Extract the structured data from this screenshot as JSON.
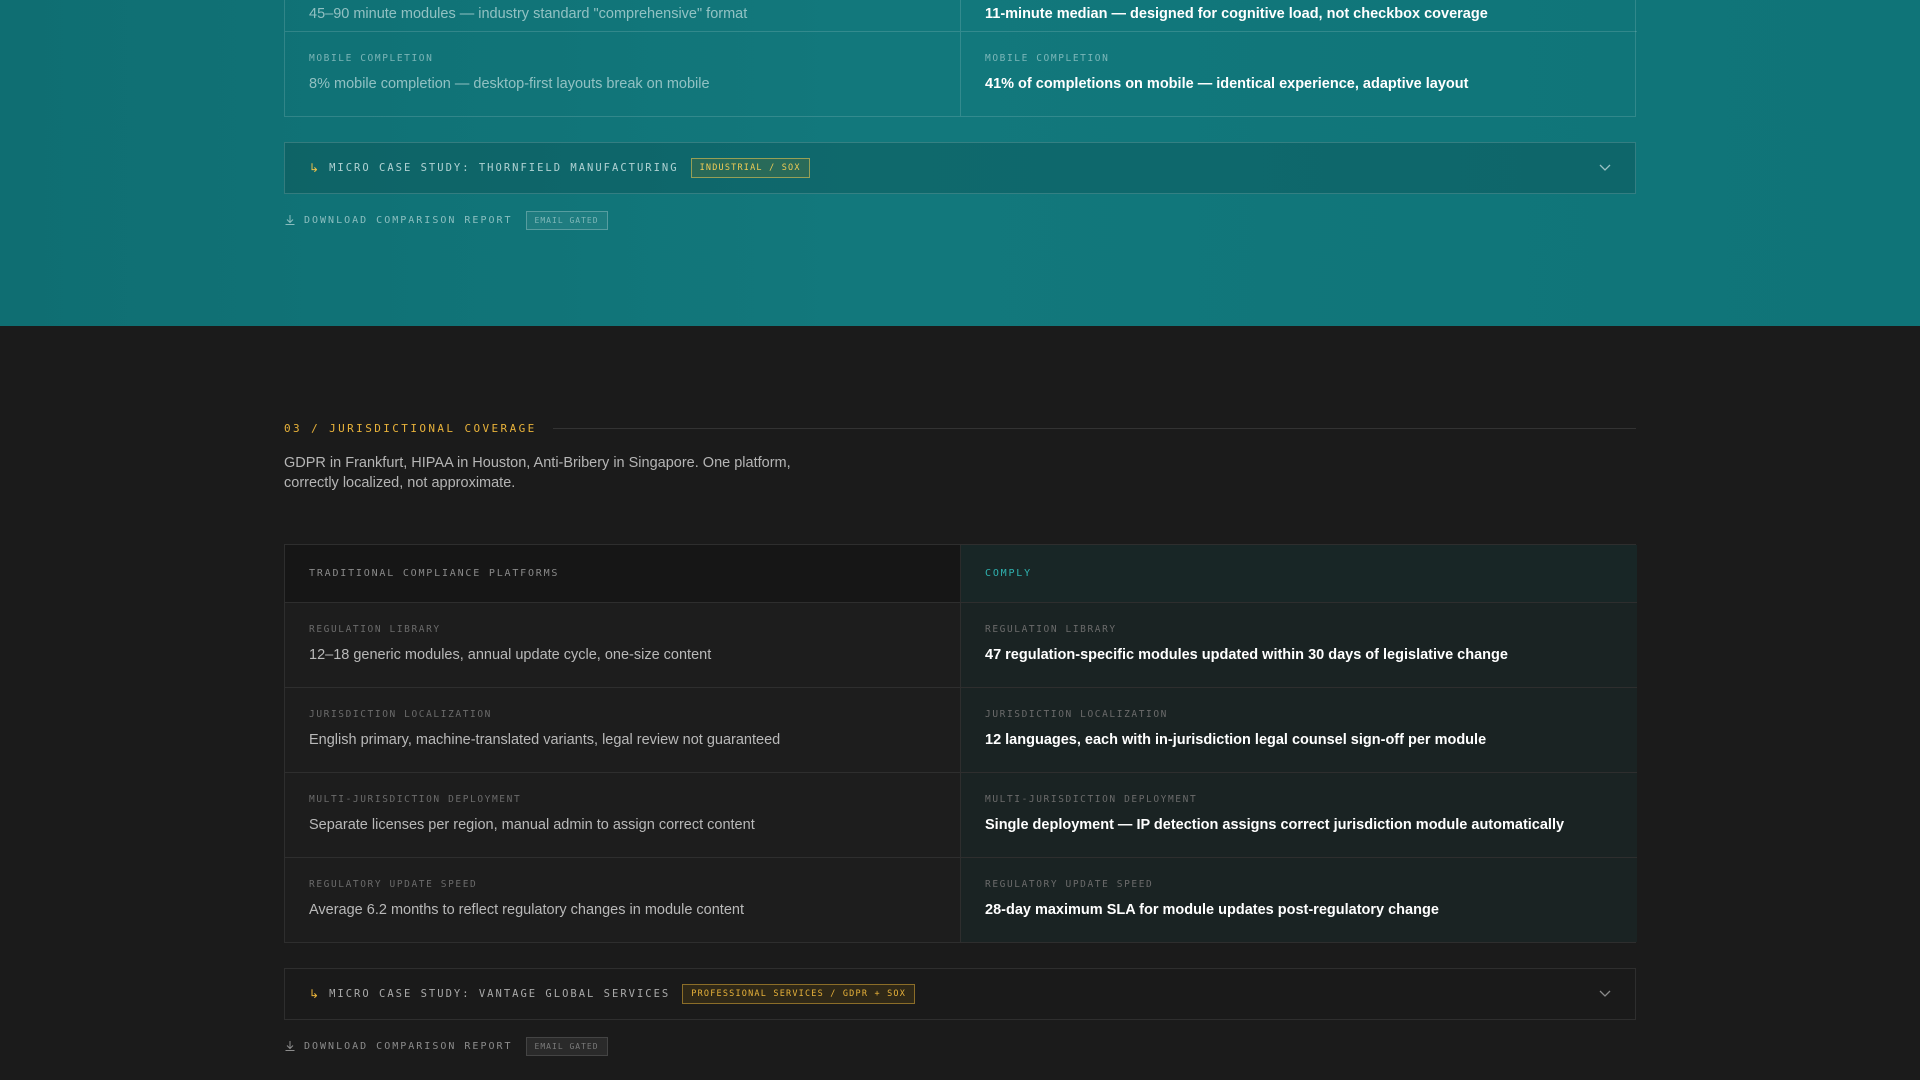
{
  "teal_section": {
    "rows": [
      {
        "label_left": "",
        "left": "45–90 minute modules — industry standard \"comprehensive\" format",
        "label_right": "",
        "right": "11-minute median — designed for cognitive load, not checkbox coverage"
      },
      {
        "label_left": "MOBILE COMPLETION",
        "left": "8% mobile completion — desktop-first layouts break on mobile",
        "label_right": "MOBILE COMPLETION",
        "right": "41% of completions on mobile — identical experience, adaptive layout"
      }
    ],
    "case_study": {
      "arrow": "↳",
      "title": "MICRO CASE STUDY: THORNFIELD MANUFACTURING",
      "tag": "INDUSTRIAL / SOX"
    },
    "download": {
      "label": "DOWNLOAD COMPARISON REPORT",
      "badge": "EMAIL GATED"
    }
  },
  "jurisdiction_section": {
    "heading": "03 / JURISDICTIONAL COVERAGE",
    "intro": "GDPR in Frankfurt, HIPAA in Houston, Anti-Bribery in Singapore. One platform, correctly localized, not approximate.",
    "col_left_header": "TRADITIONAL COMPLIANCE PLATFORMS",
    "col_right_header": "COMPLY",
    "rows": [
      {
        "label_left": "REGULATION LIBRARY",
        "left": "12–18 generic modules, annual update cycle, one-size content",
        "label_right": "REGULATION LIBRARY",
        "right": "47 regulation-specific modules updated within 30 days of legislative change"
      },
      {
        "label_left": "JURISDICTION LOCALIZATION",
        "left": "English primary, machine-translated variants, legal review not guaranteed",
        "label_right": "JURISDICTION LOCALIZATION",
        "right": "12 languages, each with in-jurisdiction legal counsel sign-off per module"
      },
      {
        "label_left": "MULTI-JURISDICTION DEPLOYMENT",
        "left": "Separate licenses per region, manual admin to assign correct content",
        "label_right": "MULTI-JURISDICTION DEPLOYMENT",
        "right": "Single deployment — IP detection assigns correct jurisdiction module automatically"
      },
      {
        "label_left": "REGULATORY UPDATE SPEED",
        "left": "Average 6.2 months to reflect regulatory changes in module content",
        "label_right": "REGULATORY UPDATE SPEED",
        "right": "28-day maximum SLA for module updates post-regulatory change"
      }
    ],
    "case_study": {
      "arrow": "↳",
      "title": "MICRO CASE STUDY: VANTAGE GLOBAL SERVICES",
      "tag": "PROFESSIONAL SERVICES / GDPR + SOX"
    },
    "download": {
      "label": "DOWNLOAD COMPARISON REPORT",
      "badge": "EMAIL GATED"
    }
  },
  "icons": {
    "chevron": "chevron-down-icon",
    "download": "download-icon"
  },
  "colors": {
    "teal_bg": "#12787c",
    "dark_bg": "#1b1b1b",
    "accent_amber": "#e8b23a",
    "accent_teal": "#2fb3b0"
  }
}
